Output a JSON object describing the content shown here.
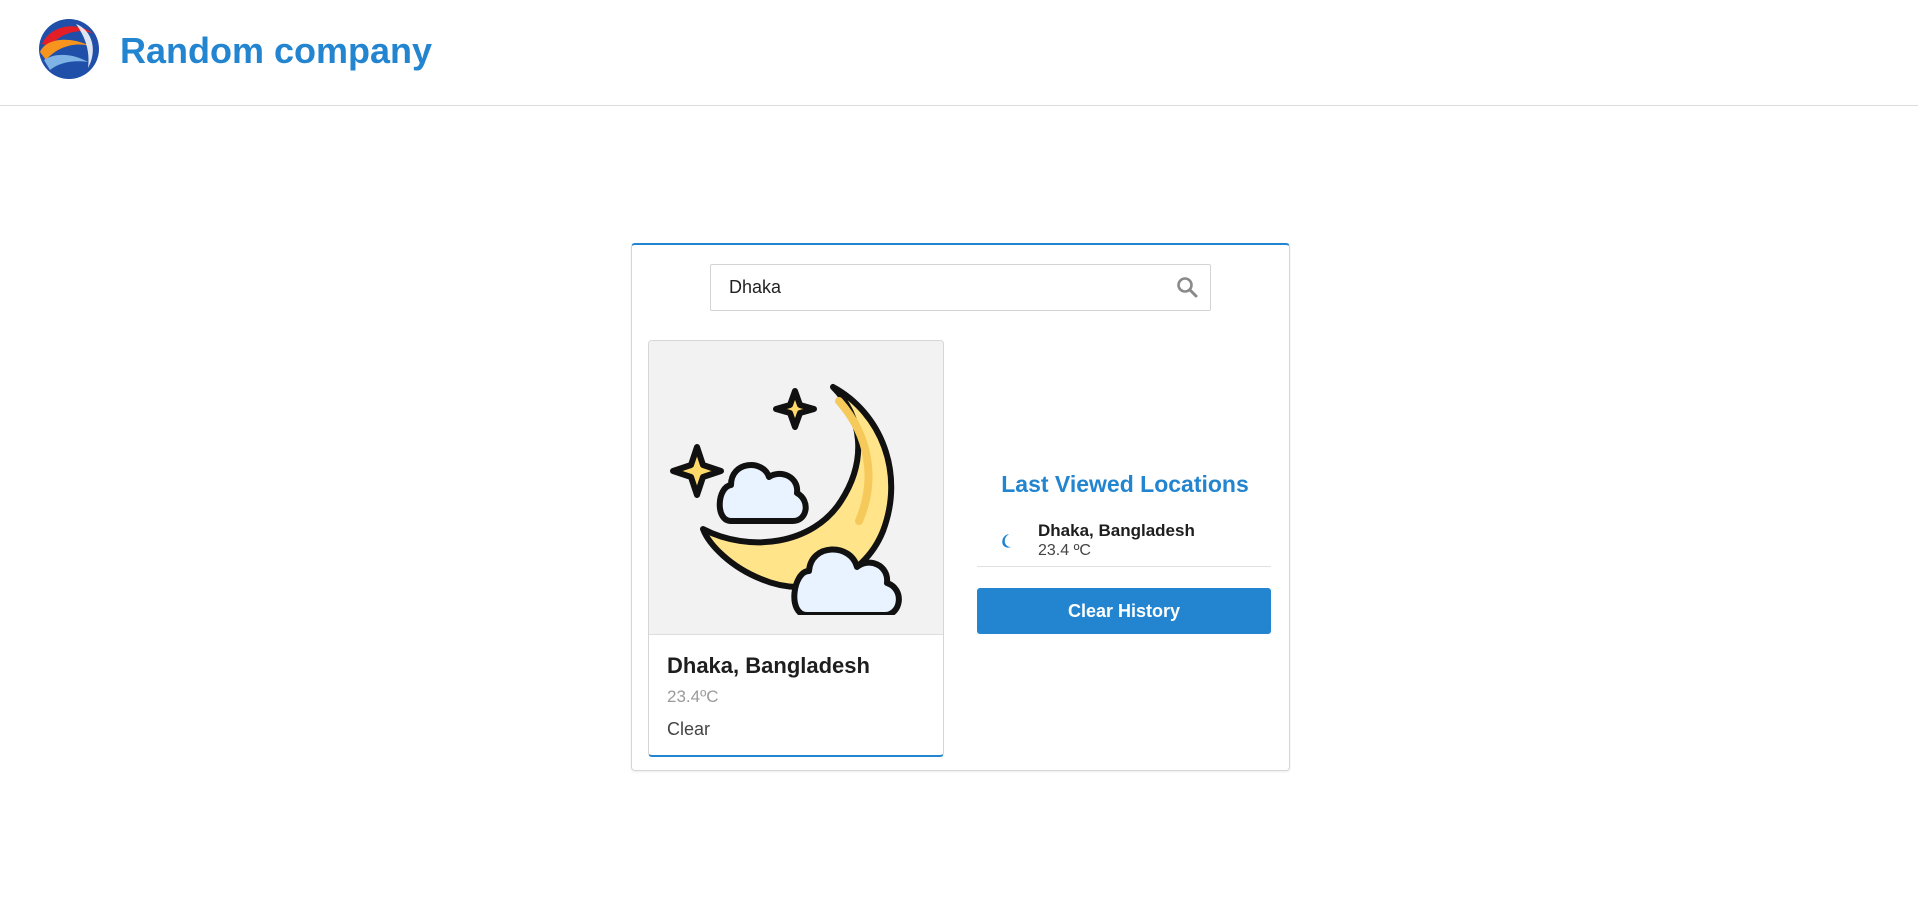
{
  "header": {
    "brand_name": "Random company",
    "logo_icon": "globe-logo-icon"
  },
  "search": {
    "value": "Dhaka",
    "icon": "search-icon"
  },
  "weather_card": {
    "icon": "moon-stars-clouds-icon",
    "location": "Dhaka, Bangladesh",
    "temperature": "23.4ºC",
    "condition": "Clear"
  },
  "history": {
    "title": "Last Viewed Locations",
    "items": [
      {
        "icon": "moon-icon",
        "location": "Dhaka, Bangladesh",
        "temperature": "23.4 ºC"
      }
    ],
    "clear_label": "Clear History"
  },
  "colors": {
    "accent": "#2385d0",
    "moon": "#ffe48a",
    "star": "#ffd96a",
    "cloud": "#e8f3ff"
  }
}
